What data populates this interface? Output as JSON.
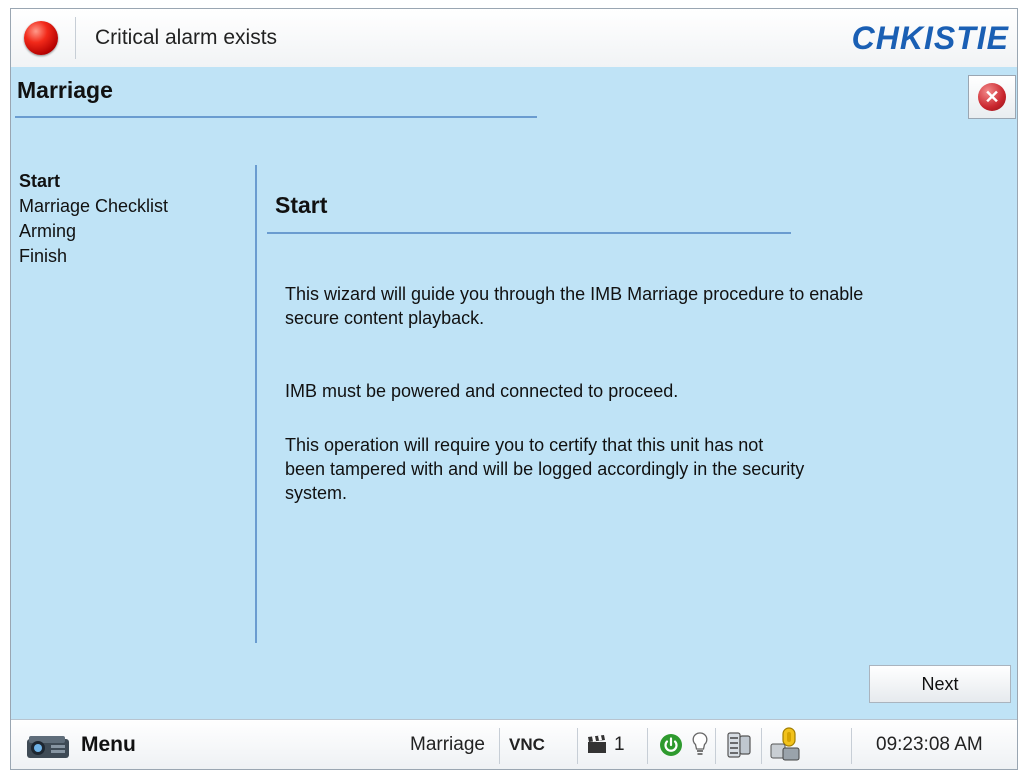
{
  "header": {
    "alarm_text": "Critical alarm exists",
    "brand": "CHKISTIE",
    "alarm_led_color": "#e0241a",
    "brand_color": "#1a5fb4"
  },
  "page": {
    "title": "Marriage",
    "close_icon": "close-circle-icon"
  },
  "wizard": {
    "steps": [
      {
        "label": "Start",
        "active": true
      },
      {
        "label": "Marriage Checklist",
        "active": false
      },
      {
        "label": "Arming",
        "active": false
      },
      {
        "label": "Finish",
        "active": false
      }
    ],
    "section_title": "Start",
    "paragraphs": [
      "This wizard will guide you through the IMB Marriage procedure to enable secure content playback.",
      "IMB must be powered and connected  to proceed.",
      "This operation will require you to certify that this unit has not been tampered with and will be logged accordingly in the security system."
    ],
    "next_label": "Next"
  },
  "statusbar": {
    "menu_label": "Menu",
    "current_page": "Marriage",
    "vnc_label": "VNC",
    "playback_count": "1",
    "time": "09:23:08 AM",
    "power_color": "#2e9a2e",
    "icons": [
      "projector-icon",
      "clapperboard-icon",
      "power-icon",
      "lamp-icon",
      "network-icon",
      "security-lock-icon"
    ]
  },
  "colors": {
    "background": "#bfe3f6",
    "rule": "#6a9cd0"
  }
}
